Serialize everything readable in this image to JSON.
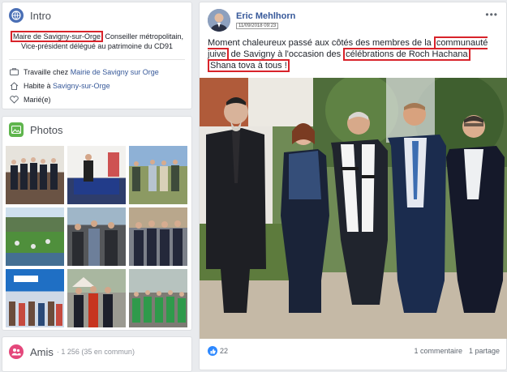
{
  "intro": {
    "title": "Intro",
    "bio_highlight": "Maire de Savigny-sur-Orge",
    "bio_rest_1": " Conseiller métropolitain,",
    "bio_rest_2": "Vice-président délégué au patrimoine du CD91",
    "work_prefix": "Travaille chez ",
    "work_link": "Mairie de Savigny sur Orge",
    "lives_prefix": "Habite à ",
    "lives_link": "Savigny-sur-Orge",
    "status": "Marié(e)"
  },
  "photos": {
    "title": "Photos"
  },
  "amis": {
    "title": "Amis",
    "count": "· 1 256 (35 en commun)"
  },
  "post": {
    "author": "Eric Mehlhorn",
    "timestamp": "11/09/2018 09:23",
    "text_1": "Moment chaleureux passé aux côtés des membres de la ",
    "hl_1": "communauté juive",
    "text_2": " de Savigny à l'occasion des ",
    "hl_2": "célébrations de Roch Hachana",
    "hl_3": "Shana tova à tous !",
    "likes": "22",
    "comments": "1 commentaire",
    "shares": "1 partage"
  },
  "colors": {
    "link": "#365899",
    "highlight": "#d8232a",
    "like": "#2d88ff"
  }
}
